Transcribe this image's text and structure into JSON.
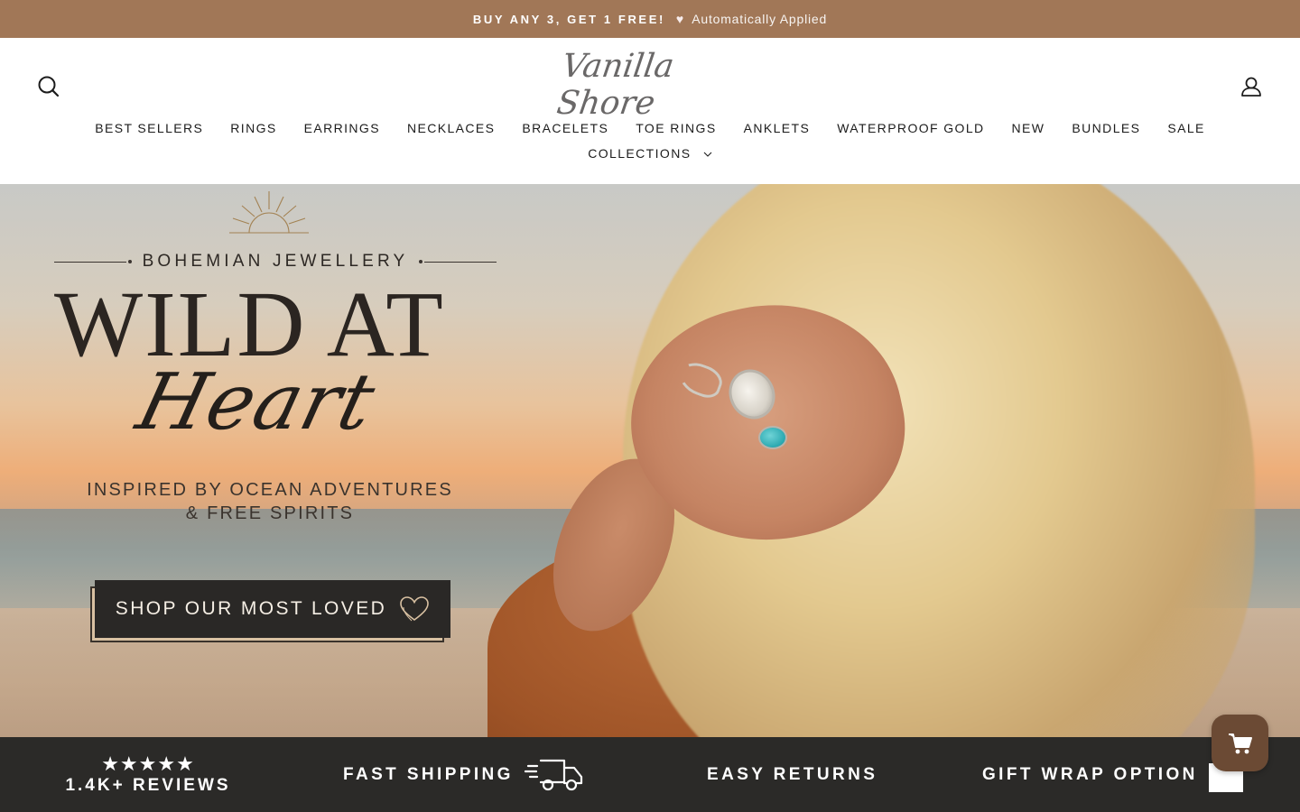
{
  "announcement": {
    "offer": "BUY ANY 3, GET 1 FREE!",
    "heart": "♥",
    "note": "Automatically Applied"
  },
  "header": {
    "logo": "Vanilla Shore",
    "nav_primary": [
      "BEST SELLERS",
      "RINGS",
      "EARRINGS",
      "NECKLACES",
      "BRACELETS",
      "TOE RINGS",
      "ANKLETS",
      "WATERPROOF GOLD",
      "NEW",
      "BUNDLES",
      "SALE"
    ],
    "nav_secondary": "COLLECTIONS"
  },
  "hero": {
    "eyebrow": "BOHEMIAN JEWELLERY",
    "title": "WILD AT",
    "script_title": "Heart",
    "subtitle_line1": "INSPIRED BY OCEAN ADVENTURES",
    "subtitle_line2": "& FREE SPIRITS",
    "cta": "SHOP OUR MOST LOVED"
  },
  "trust_bar": {
    "stars": "★★★★★",
    "reviews": "1.4K+ REVIEWS",
    "shipping": "FAST SHIPPING",
    "returns": "EASY RETURNS",
    "gift_wrap": "GIFT WRAP OPTION"
  },
  "colors": {
    "announcement_bg": "#a17757",
    "trust_bar_bg": "#2b2a28",
    "cta_bg": "#2a2826",
    "cart_fab_bg": "#6b4a34"
  },
  "icons": {
    "search": "search-icon",
    "account": "user-icon",
    "chevron": "chevron-down-icon",
    "truck": "truck-icon",
    "cart": "cart-icon",
    "heart": "heart-icon",
    "gift": "gift-icon"
  }
}
